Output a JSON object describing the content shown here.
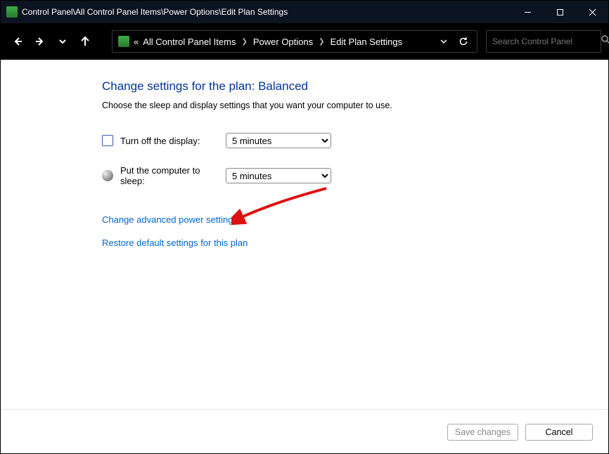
{
  "title": "Control Panel\\All Control Panel Items\\Power Options\\Edit Plan Settings",
  "breadcrumb": {
    "prefix": "«",
    "items": [
      "All Control Panel Items",
      "Power Options",
      "Edit Plan Settings"
    ]
  },
  "search": {
    "placeholder": "Search Control Panel"
  },
  "page": {
    "heading": "Change settings for the plan: Balanced",
    "subtext": "Choose the sleep and display settings that you want your computer to use."
  },
  "settings": {
    "display_off": {
      "label": "Turn off the display:",
      "value": "5 minutes"
    },
    "sleep": {
      "label": "Put the computer to sleep:",
      "value": "5 minutes"
    }
  },
  "links": {
    "advanced": "Change advanced power settings",
    "restore": "Restore default settings for this plan"
  },
  "buttons": {
    "save": "Save changes",
    "cancel": "Cancel"
  }
}
